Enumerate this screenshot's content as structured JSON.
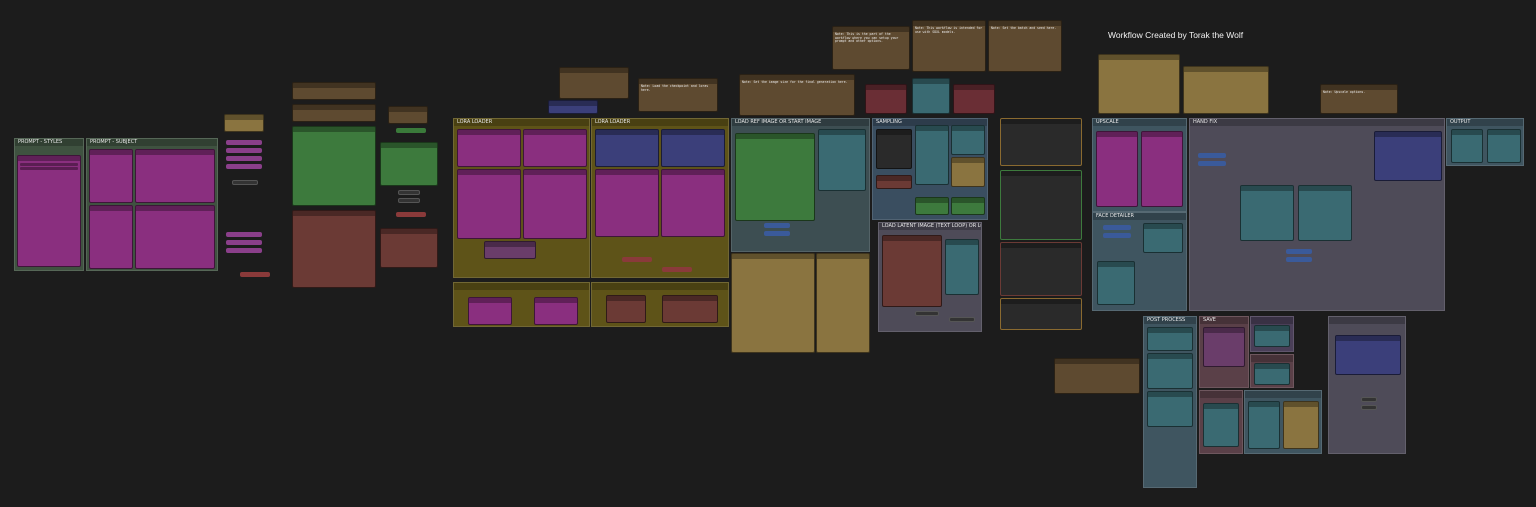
{
  "canvas": {
    "title": "Workflow Created by Torak the Wolf",
    "subtitle": "",
    "background": "#1c1c1c"
  },
  "groups": {
    "prompt_styles": "PROMPT - STYLES",
    "prompt_subject": "PROMPT - SUBJECT",
    "lora_loader": "LORA LOADER",
    "lora_loader_2": "LORA LOADER",
    "load_ref_image": "LOAD REF IMAGE OR START IMAGE",
    "load_latent": "LOAD LATENT IMAGE (TEXT LOOP) OR LOOP NODES",
    "sampling": "SAMPLING",
    "upscale": "UPSCALE",
    "face_detailer": "FACE DETAILER",
    "hand_fix": "HAND FIX",
    "output": "OUTPUT",
    "postprocess": "POST PROCESS",
    "save_a": "SAVE",
    "save_b": "SAVE"
  },
  "notes": {
    "note_1": "Note: This is the part of the workflow where you can setup your prompt and other options.",
    "note_2": "Note: Load the checkpoint and loras here.",
    "note_3": "Note: Set the image size for the final generation here.",
    "note_4": "Note: This workflow is intended for use with SDXL models.",
    "note_5": "Note: Upscale options.",
    "note_6": "Note: Set the batch and seed here."
  }
}
